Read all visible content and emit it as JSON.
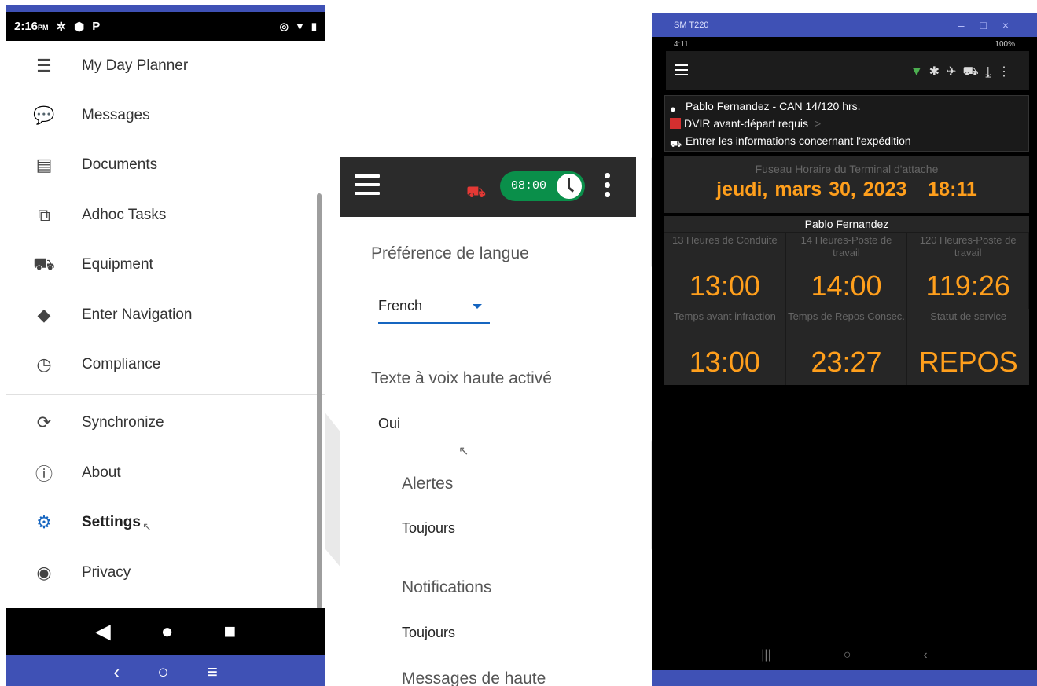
{
  "panel1": {
    "status": {
      "time": "2:16",
      "ampm": "PM"
    },
    "menu": [
      {
        "label": "My Day Planner",
        "icon": "list-numbered-icon"
      },
      {
        "label": "Messages",
        "icon": "chat-bubbles-icon"
      },
      {
        "label": "Documents",
        "icon": "document-icon"
      },
      {
        "label": "Adhoc Tasks",
        "icon": "tasks-icon"
      },
      {
        "label": "Equipment",
        "icon": "truck-icon"
      },
      {
        "label": "Enter Navigation",
        "icon": "directions-icon"
      },
      {
        "label": "Compliance",
        "icon": "clock-icon"
      },
      {
        "label": "Synchronize",
        "icon": "sync-icon"
      },
      {
        "label": "About",
        "icon": "info-icon"
      },
      {
        "label": "Settings",
        "icon": "gear-icon"
      },
      {
        "label": "Privacy",
        "icon": "eye-icon"
      }
    ],
    "active_item": "Settings"
  },
  "panel2": {
    "timer": "08:00",
    "language_heading": "Préférence de langue",
    "language_value": "French",
    "tts_heading": "Texte à voix haute activé",
    "tts_value": "Oui",
    "alerts_heading": "Alertes",
    "alerts_value": "Toujours",
    "notifications_heading": "Notifications",
    "notifications_value": "Toujours",
    "messages_heading": "Messages de haute"
  },
  "panel3": {
    "window_title": "SM T220",
    "status_time": "4:11",
    "status_right": "100%",
    "driver_line": "Pablo Fernandez - CAN 14/120 hrs.",
    "dvir_line": "DVIR avant-départ requis",
    "dvir_chevron": ">",
    "shipment_line": "Entrer les informations concernant l'expédition",
    "timezone_label": "Fuseau Horaire du Terminal d'attache",
    "date": "jeudi, mars 30, 2023",
    "clock": "18:11",
    "driver_name": "Pablo Fernandez",
    "cells": [
      {
        "label": "13 Heures de Conduite",
        "value": "13:00"
      },
      {
        "label": "14 Heures-Poste de travail",
        "value": "14:00"
      },
      {
        "label": "120 Heures-Poste de travail",
        "value": "119:26"
      },
      {
        "label": "Temps avant infraction",
        "value": "13:00"
      },
      {
        "label": "Temps de Repos Consec.",
        "value": "23:27"
      },
      {
        "label": "Statut de service",
        "value": "REPOS"
      }
    ]
  },
  "colors": {
    "accent": "#3f51b5",
    "orange": "#ff9f1c",
    "green_pill": "#0a8f4a",
    "settings_blue": "#1565c0"
  }
}
